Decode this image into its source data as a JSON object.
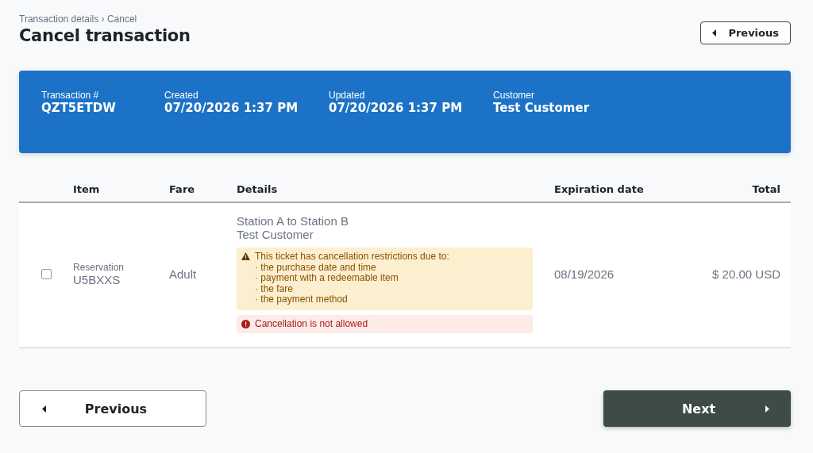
{
  "breadcrumb": "Transaction details › Cancel",
  "title": "Cancel transaction",
  "header_button": {
    "label": "Previous"
  },
  "summary": [
    {
      "label": "Transaction #",
      "value": "QZT5ETDW"
    },
    {
      "label": "Created",
      "value": "07/20/2026 1:37 PM"
    },
    {
      "label": "Updated",
      "value": "07/20/2026 1:37 PM"
    },
    {
      "label": "Customer",
      "value": "Test Customer"
    }
  ],
  "table": {
    "columns": [
      "Item",
      "Fare",
      "Details",
      "Expiration date",
      "Total"
    ],
    "rows": [
      {
        "checked": false,
        "item_type": "Reservation",
        "item_code": "U5BXXS",
        "fare": "Adult",
        "route": "Station A to Station B",
        "customer": "Test Customer",
        "alerts": [
          {
            "kind": "warning",
            "text": "This ticket has cancellation restrictions due to:",
            "items": [
              "· the purchase date and time",
              "· payment with a redeemable item",
              "· the fare",
              "· the payment method"
            ]
          },
          {
            "kind": "error",
            "text": "Cancellation is not allowed"
          }
        ],
        "expiration": "08/19/2026",
        "total": "$ 20.00 USD"
      }
    ]
  },
  "footer": {
    "previous": "Previous",
    "next": "Next"
  }
}
